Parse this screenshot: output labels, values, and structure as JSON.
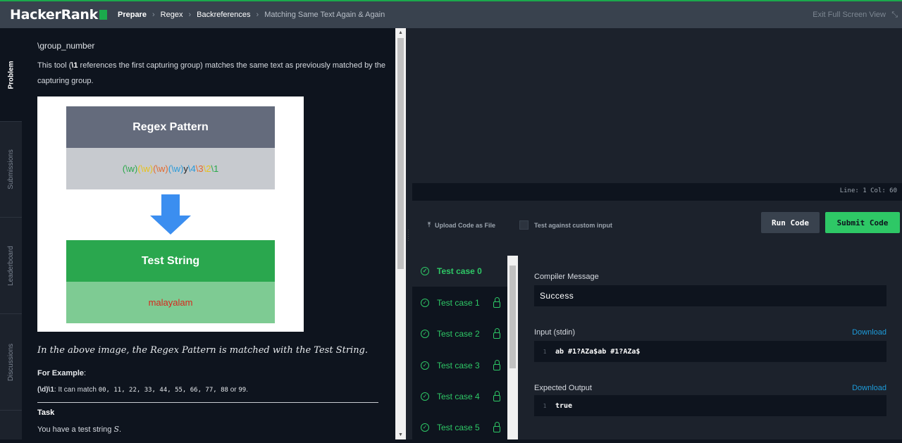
{
  "topbar": {
    "logo": "HackerRank",
    "breadcrumbs": [
      "Prepare",
      "Regex",
      "Backreferences",
      "Matching Same Text Again & Again"
    ],
    "exit_label": "Exit Full Screen View"
  },
  "siderail": {
    "tabs": [
      "Problem",
      "Submissions",
      "Leaderboard",
      "Discussions"
    ],
    "active": "Problem"
  },
  "problem": {
    "heading": "\\group_number",
    "intro_prefix": "This tool (",
    "intro_bold": "\\1",
    "intro_suffix": " references the first capturing group) matches the same text as previously matched by the capturing group.",
    "diagram": {
      "pattern_title": "Regex Pattern",
      "pattern_tokens": [
        {
          "text": "(\\w)",
          "color": "#2aa84a"
        },
        {
          "text": "(\\w)",
          "color": "#e8c21a"
        },
        {
          "text": "(\\w)",
          "color": "#e46a2e"
        },
        {
          "text": "(\\w)",
          "color": "#2a9ad8"
        },
        {
          "text": "y",
          "color": "#222222"
        },
        {
          "text": "\\4",
          "color": "#2a9ad8"
        },
        {
          "text": "\\3",
          "color": "#e46a2e"
        },
        {
          "text": "\\2",
          "color": "#e8c21a"
        },
        {
          "text": "\\1",
          "color": "#2aa84a"
        }
      ],
      "test_title": "Test String",
      "test_value": "malayalam"
    },
    "caption": "In the above image, the Regex Pattern is matched with the Test String.",
    "example_label": "For Example",
    "example_pattern": "(\\d)\\1",
    "example_text": ": It can match ",
    "example_values": "00, 11, 22, 33, 44, 55, 66, 77, 88",
    "example_or": " or ",
    "example_last": "99",
    "task_label": "Task",
    "task_text": "You have a test string ",
    "task_var": "S",
    "task_end": "."
  },
  "editor": {
    "position": "Line: 1 Col: 60"
  },
  "actions": {
    "upload_label": "Upload Code as File",
    "custom_input_label": "Test against custom input",
    "run_label": "Run Code",
    "submit_label": "Submit Code"
  },
  "tests": [
    {
      "label": "Test case 0",
      "locked": false,
      "active": true
    },
    {
      "label": "Test case 1",
      "locked": true,
      "active": false
    },
    {
      "label": "Test case 2",
      "locked": true,
      "active": false
    },
    {
      "label": "Test case 3",
      "locked": true,
      "active": false
    },
    {
      "label": "Test case 4",
      "locked": true,
      "active": false
    },
    {
      "label": "Test case 5",
      "locked": true,
      "active": false
    }
  ],
  "results": {
    "compiler_label": "Compiler Message",
    "compiler_value": "Success",
    "input_label": "Input (stdin)",
    "input_line": "1",
    "input_value": "ab #1?AZa$ab #1?AZa$",
    "expected_label": "Expected Output",
    "expected_line": "1",
    "expected_value": "true",
    "download_label": "Download"
  },
  "colors": {
    "brand_green": "#1ba94c",
    "accent_green": "#2ec866",
    "link_blue": "#1d9bd9"
  }
}
